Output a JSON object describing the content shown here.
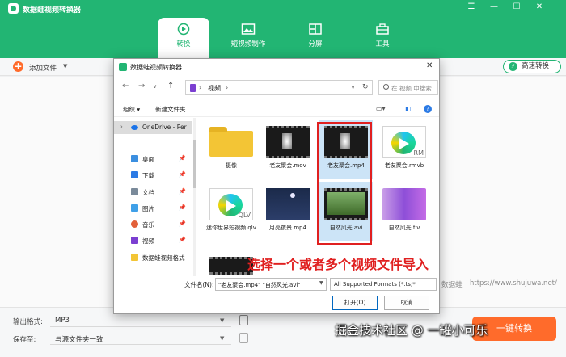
{
  "app": {
    "title": "数据蛙视频转换器",
    "window_controls": [
      "☰",
      "—",
      "☐",
      "✕"
    ]
  },
  "tabs": [
    {
      "label": "转换",
      "icon": "convert-icon",
      "active": true
    },
    {
      "label": "短视频制作",
      "icon": "image-icon",
      "active": false
    },
    {
      "label": "分屏",
      "icon": "split-screen-icon",
      "active": false
    },
    {
      "label": "工具",
      "icon": "toolbox-icon",
      "active": false
    }
  ],
  "toolbar": {
    "add_file_label": "添加文件",
    "fast_convert_label": "高速转换"
  },
  "bottom": {
    "output_format_label": "输出格式:",
    "output_format_value": "MP3",
    "save_to_label": "保存至:",
    "save_to_value": "与源文件夹一致",
    "convert_button": "一键转换"
  },
  "watermark": {
    "site_label": "数据蛙",
    "site_url": "https://www.shujuwa.net/",
    "community": "掘金技术社区 @ 一罐小可乐"
  },
  "dialog": {
    "title": "数据蛙视频转换器",
    "path": "视频",
    "search_placeholder": "在 视频 中搜索",
    "organize_label": "组织 ▾",
    "new_folder_label": "新建文件夹",
    "nav": [
      {
        "label": "OneDrive - Per",
        "icon": "cloud-icon",
        "color": "#1a73e8",
        "pinned": false
      },
      {
        "label": "桌面",
        "icon": "desktop-icon",
        "color": "#3b8fe0",
        "pinned": true
      },
      {
        "label": "下载",
        "icon": "download-icon",
        "color": "#2c7be5",
        "pinned": true
      },
      {
        "label": "文档",
        "icon": "document-icon",
        "color": "#7a8a9a",
        "pinned": true
      },
      {
        "label": "图片",
        "icon": "picture-icon",
        "color": "#3fa0e8",
        "pinned": true
      },
      {
        "label": "音乐",
        "icon": "music-icon",
        "color": "#e2603a",
        "pinned": true
      },
      {
        "label": "视频",
        "icon": "video-icon",
        "color": "#7b3fd1",
        "pinned": true
      },
      {
        "label": "数据蛙视频格式",
        "icon": "folder-icon",
        "color": "#f3c535",
        "pinned": false
      }
    ],
    "files": [
      {
        "name": "摄像",
        "kind": "folder",
        "selected": false
      },
      {
        "name": "老友聚会.mov",
        "kind": "film",
        "selected": false
      },
      {
        "name": "老友聚会.mp4",
        "kind": "film",
        "selected": true
      },
      {
        "name": "老友聚会.rmvb",
        "kind": "rm",
        "selected": false
      },
      {
        "name": "迷你世界短视频.qlv",
        "kind": "qlv",
        "selected": false
      },
      {
        "name": "月亮夜景.mp4",
        "kind": "night",
        "selected": false
      },
      {
        "name": "自然风光.avi",
        "kind": "nature",
        "selected": true
      },
      {
        "name": "自然风光.flv",
        "kind": "flv",
        "selected": false
      }
    ],
    "filename_label": "文件名(N):",
    "filename_value": "\"老友聚会.mp4\" \"自然风光.avi\"",
    "filter_value": "All Supported Formats (*.ts;*",
    "open_button": "打开(O)",
    "cancel_button": "取消"
  },
  "annotation": {
    "text": "选择一个或者多个视频文件导入",
    "color": "#e02020"
  }
}
